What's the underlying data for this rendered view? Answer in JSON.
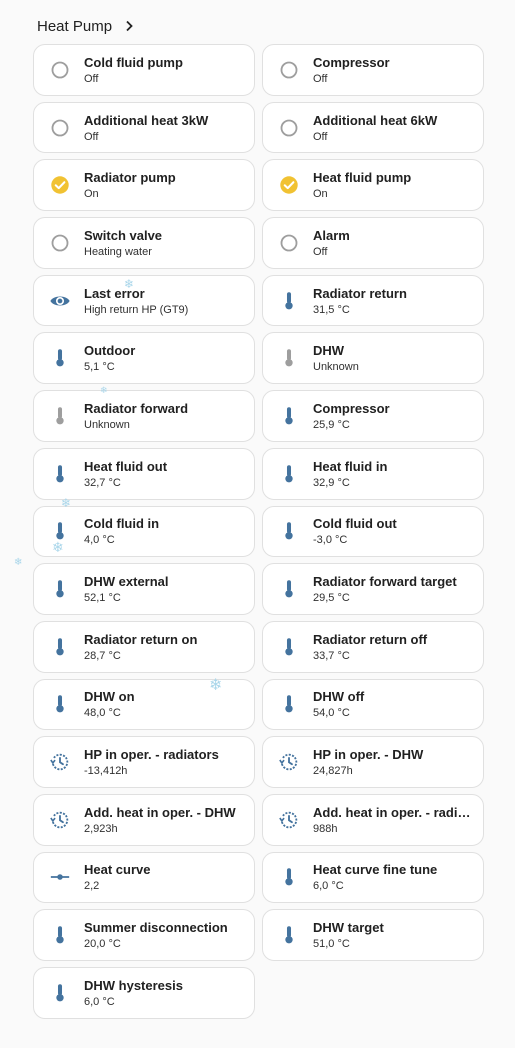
{
  "header": {
    "title": "Heat Pump"
  },
  "colors": {
    "active": "#f1c232",
    "inactive": "#9e9e9e",
    "sensor": "#44739e",
    "unknown": "#9e9e9e"
  },
  "tiles": [
    {
      "name": "Cold fluid pump",
      "state": "Off",
      "icon": "circle-outline-icon"
    },
    {
      "name": "Compressor",
      "state": "Off",
      "icon": "circle-outline-icon"
    },
    {
      "name": "Additional heat 3kW",
      "state": "Off",
      "icon": "circle-outline-icon"
    },
    {
      "name": "Additional heat 6kW",
      "state": "Off",
      "icon": "circle-outline-icon"
    },
    {
      "name": "Radiator pump",
      "state": "On",
      "icon": "check-circle-icon"
    },
    {
      "name": "Heat fluid pump",
      "state": "On",
      "icon": "check-circle-icon"
    },
    {
      "name": "Switch valve",
      "state": "Heating water",
      "icon": "circle-outline-icon"
    },
    {
      "name": "Alarm",
      "state": "Off",
      "icon": "circle-outline-icon"
    },
    {
      "name": "Last error",
      "state": "High return HP (GT9)",
      "icon": "eye-icon"
    },
    {
      "name": "Radiator return",
      "state": "31,5 °C",
      "icon": "thermometer-icon"
    },
    {
      "name": "Outdoor",
      "state": "5,1 °C",
      "icon": "thermometer-icon"
    },
    {
      "name": "DHW",
      "state": "Unknown",
      "icon": "thermometer-gray-icon"
    },
    {
      "name": "Radiator forward",
      "state": "Unknown",
      "icon": "thermometer-gray-icon"
    },
    {
      "name": "Compressor",
      "state": "25,9 °C",
      "icon": "thermometer-icon"
    },
    {
      "name": "Heat fluid out",
      "state": "32,7 °C",
      "icon": "thermometer-icon"
    },
    {
      "name": "Heat fluid in",
      "state": "32,9 °C",
      "icon": "thermometer-icon"
    },
    {
      "name": "Cold fluid in",
      "state": "4,0 °C",
      "icon": "thermometer-icon"
    },
    {
      "name": "Cold fluid out",
      "state": "-3,0 °C",
      "icon": "thermometer-icon"
    },
    {
      "name": "DHW external",
      "state": "52,1 °C",
      "icon": "thermometer-icon"
    },
    {
      "name": "Radiator forward target",
      "state": "29,5 °C",
      "icon": "thermometer-icon"
    },
    {
      "name": "Radiator return on",
      "state": "28,7 °C",
      "icon": "thermometer-icon"
    },
    {
      "name": "Radiator return off",
      "state": "33,7 °C",
      "icon": "thermometer-icon"
    },
    {
      "name": "DHW on",
      "state": "48,0 °C",
      "icon": "thermometer-icon"
    },
    {
      "name": "DHW off",
      "state": "54,0 °C",
      "icon": "thermometer-icon"
    },
    {
      "name": "HP in oper. - radiators",
      "state": "-13,412h",
      "icon": "clock-history-icon"
    },
    {
      "name": "HP in oper. - DHW",
      "state": "24,827h",
      "icon": "clock-history-icon"
    },
    {
      "name": "Add. heat in oper. - DHW",
      "state": "2,923h",
      "icon": "clock-history-icon"
    },
    {
      "name": "Add. heat in oper. - radiators",
      "state": "988h",
      "icon": "clock-history-icon"
    },
    {
      "name": "Heat curve",
      "state": "2,2",
      "icon": "slider-icon"
    },
    {
      "name": "Heat curve fine tune",
      "state": "6,0 °C",
      "icon": "thermometer-icon"
    },
    {
      "name": "Summer disconnection",
      "state": "20,0 °C",
      "icon": "thermometer-icon"
    },
    {
      "name": "DHW target",
      "state": "51,0 °C",
      "icon": "thermometer-icon"
    },
    {
      "name": "DHW hysteresis",
      "state": "6,0 °C",
      "icon": "thermometer-icon"
    }
  ]
}
